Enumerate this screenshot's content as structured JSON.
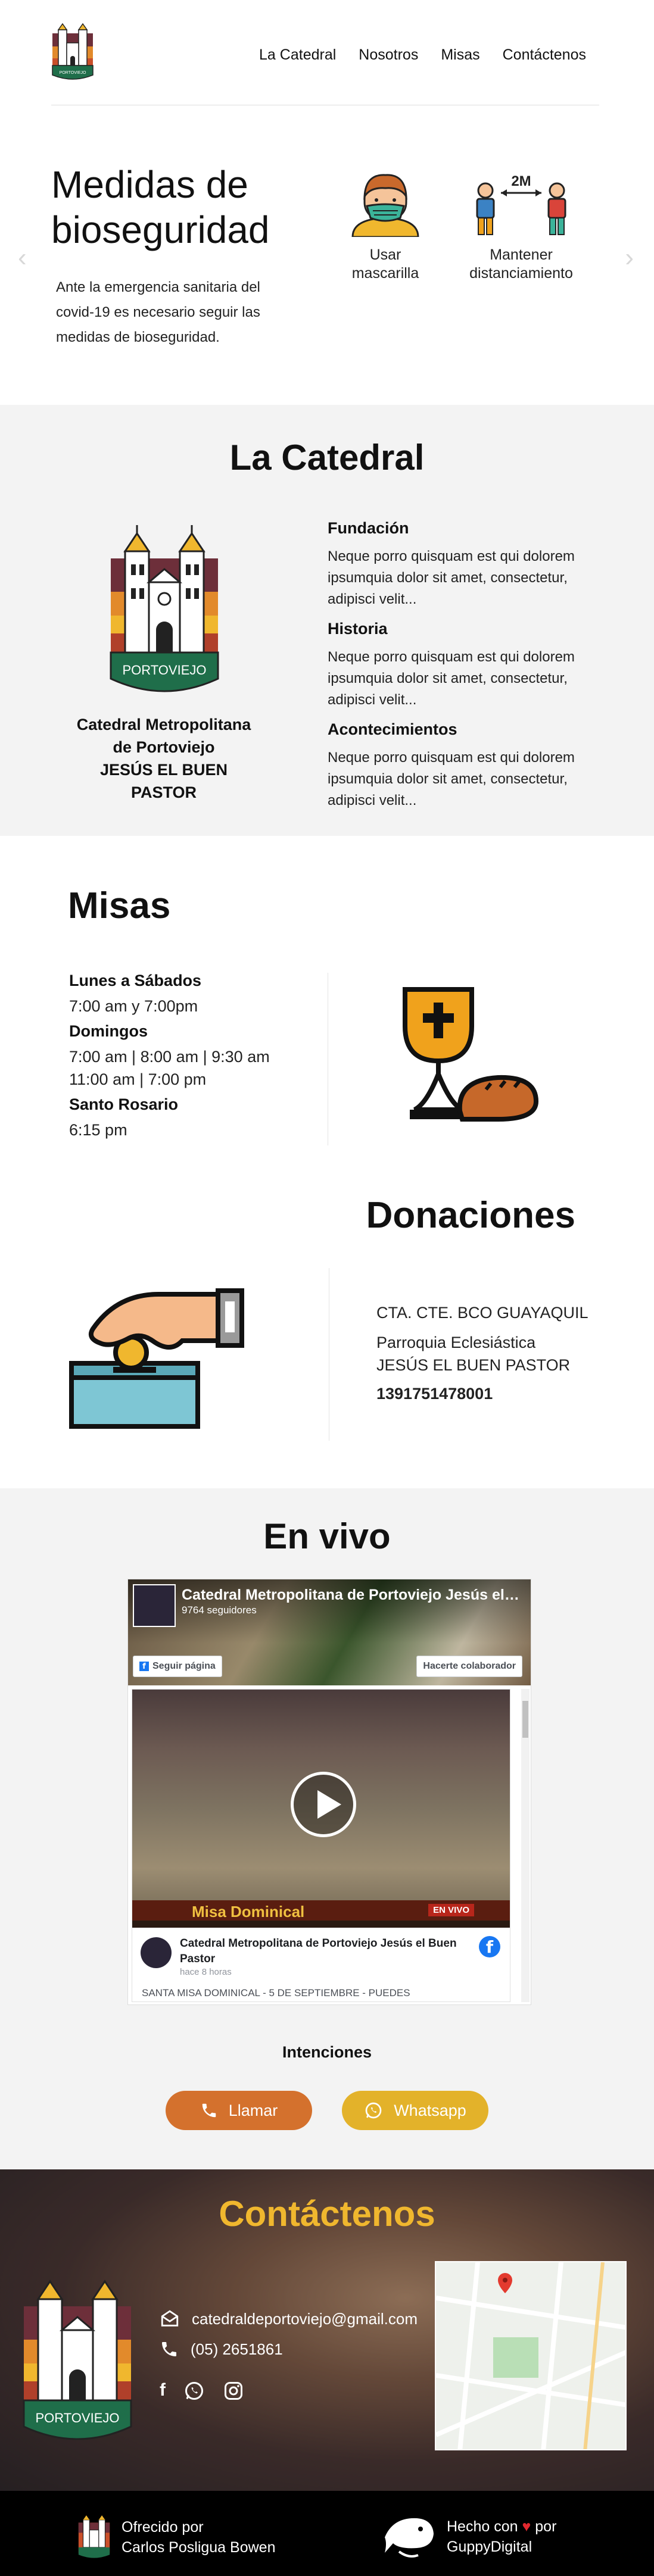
{
  "nav": {
    "logo_text": "PORTOVIEJO",
    "items": [
      {
        "label": "La Catedral"
      },
      {
        "label": "Nosotros"
      },
      {
        "label": "Misas"
      },
      {
        "label": "Contáctenos"
      }
    ]
  },
  "hero": {
    "title": "Medidas de bioseguridad",
    "text": "Ante la emergencia sanitaria del covid-19 es necesario seguir las medidas de bioseguridad.",
    "prev_arrow": "‹",
    "next_arrow": "›",
    "cards": [
      {
        "label": "Usar mascarilla",
        "icon": "mask-person-icon"
      },
      {
        "label": "Mantener distanciamiento",
        "icon": "social-distance-icon",
        "distance": "2M"
      }
    ]
  },
  "catedral": {
    "title": "La Catedral",
    "emblem_text": "PORTOVIEJO",
    "caption_line1": "Catedral Metropolitana",
    "caption_line2": "de Portoviejo",
    "caption_line3": "JESÚS EL BUEN PASTOR",
    "sections": [
      {
        "heading": "Fundación",
        "text": "Neque porro quisquam est qui dolorem ipsumquia dolor sit amet, consectetur, adipisci velit..."
      },
      {
        "heading": "Historia",
        "text": "Neque porro quisquam est qui dolorem ipsumquia dolor sit amet, consectetur, adipisci velit..."
      },
      {
        "heading": "Acontecimientos",
        "text": "Neque porro quisquam est qui dolorem ipsumquia dolor sit amet, consectetur, adipisci velit..."
      }
    ]
  },
  "misas": {
    "title": "Misas",
    "schedule": [
      {
        "day": "Lunes a Sábados",
        "times": [
          "7:00 am y 7:00pm"
        ]
      },
      {
        "day": "Domingos",
        "times": [
          "7:00 am | 8:00 am | 9:30 am",
          "11:00 am | 7:00 pm"
        ]
      },
      {
        "day": "Santo Rosario",
        "times": [
          "6:15 pm"
        ]
      }
    ]
  },
  "donaciones": {
    "title": "Donaciones",
    "account_type": "CTA. CTE. BCO GUAYAQUIL",
    "holder_line1": "Parroquia Eclesiástica",
    "holder_line2": "JESÚS EL BUEN PASTOR",
    "account_number": "1391751478001"
  },
  "vivo": {
    "title": "En vivo",
    "fb": {
      "page_name": "Catedral Metropolitana de Portoviejo Jesús el Buen Pastor",
      "followers": "9764 seguidores",
      "follow_btn": "Seguir página",
      "collab_btn": "Hacerte colaborador",
      "video_banner": "Misa Dominical",
      "live_badge": "EN VIVO",
      "post_author": "Catedral Metropolitana de Portoviejo Jesús el Buen Pastor",
      "post_time": "hace 8 horas",
      "post_caption": "SANTA MISA DOMINICAL - 5 DE SEPTIEMBRE - PUEDES"
    },
    "intentions": "Intenciones",
    "call_label": "Llamar",
    "whatsapp_label": "Whatsapp",
    "colors": {
      "call": "#d4712d",
      "whatsapp": "#e3b22a"
    }
  },
  "contacto": {
    "title": "Contáctenos",
    "email": "catedraldeportoviejo@gmail.com",
    "phone": "(05) 2651861",
    "emblem_text": "PORTOVIEJO",
    "socials": [
      "facebook-icon",
      "whatsapp-icon",
      "instagram-icon"
    ],
    "accent": "#f0b72e"
  },
  "footer": {
    "offered_line1": "Ofrecido por",
    "offered_line2": "Carlos Posligua Bowen",
    "made_prefix": "Hecho con",
    "heart": "♥",
    "made_suffix": "por",
    "made_line2": "GuppyDigital"
  }
}
